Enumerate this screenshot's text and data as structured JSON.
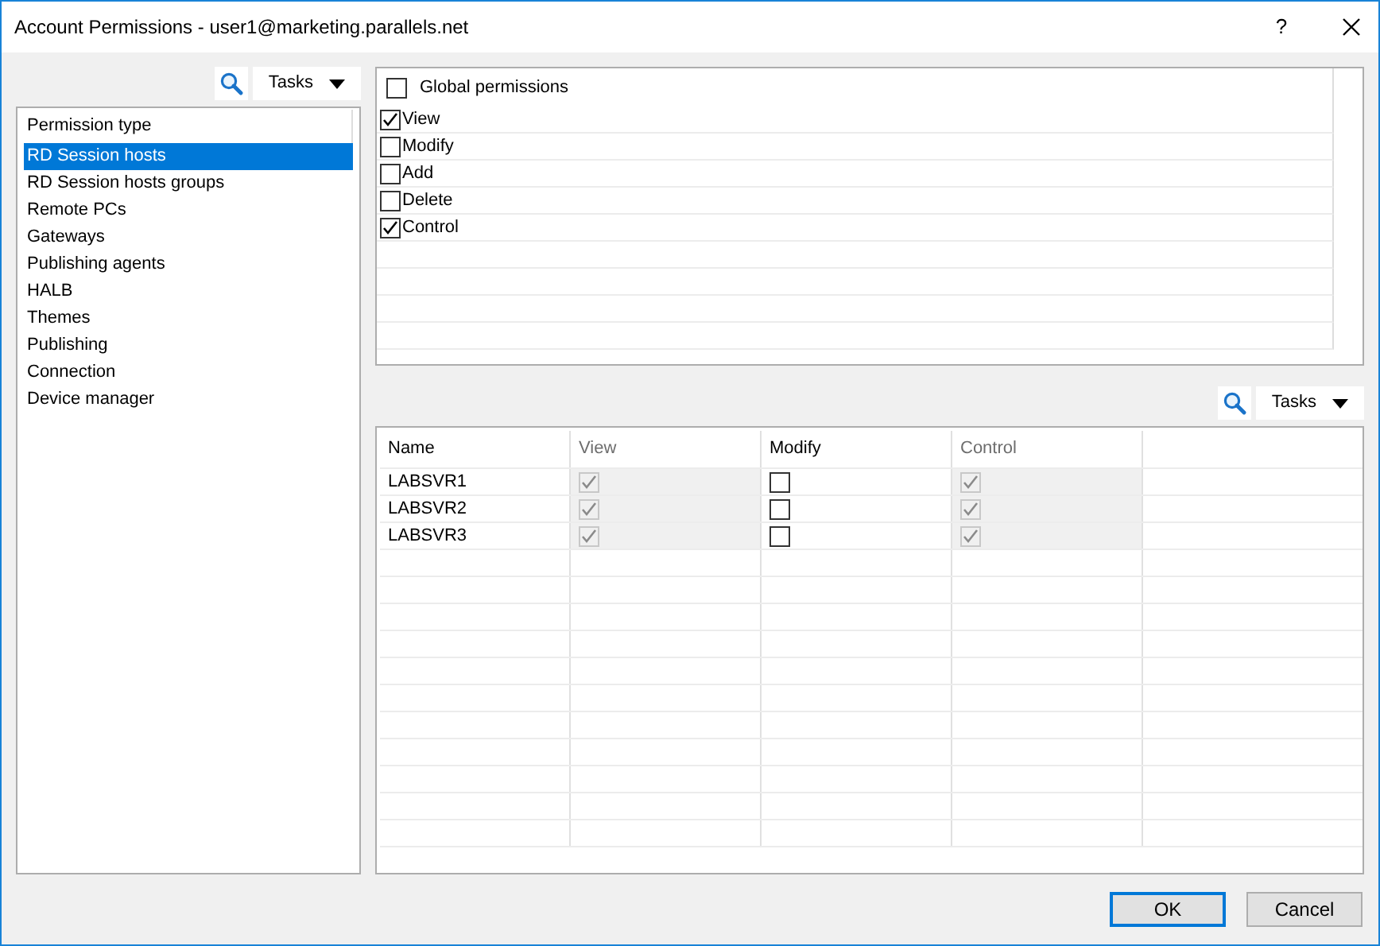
{
  "window": {
    "title": "Account Permissions - user1@marketing.parallels.net",
    "help": "?"
  },
  "permission_types": {
    "tasks_label": "Tasks",
    "header": "Permission type",
    "items": [
      {
        "label": "RD Session hosts",
        "selected": true
      },
      {
        "label": "RD Session hosts groups",
        "selected": false
      },
      {
        "label": "Remote PCs",
        "selected": false
      },
      {
        "label": "Gateways",
        "selected": false
      },
      {
        "label": "Publishing agents",
        "selected": false
      },
      {
        "label": "HALB",
        "selected": false
      },
      {
        "label": "Themes",
        "selected": false
      },
      {
        "label": "Publishing",
        "selected": false
      },
      {
        "label": "Connection",
        "selected": false
      },
      {
        "label": "Device manager",
        "selected": false
      }
    ]
  },
  "permissions": {
    "global": {
      "label": "Global permissions",
      "checked": false
    },
    "items": [
      {
        "label": "View",
        "checked": true
      },
      {
        "label": "Modify",
        "checked": false
      },
      {
        "label": "Add",
        "checked": false
      },
      {
        "label": "Delete",
        "checked": false
      },
      {
        "label": "Control",
        "checked": true
      }
    ]
  },
  "servers": {
    "tasks_label": "Tasks",
    "columns": [
      {
        "label": "Name",
        "disabled": false
      },
      {
        "label": "View",
        "disabled": true
      },
      {
        "label": "Modify",
        "disabled": false
      },
      {
        "label": "Control",
        "disabled": true
      }
    ],
    "rows": [
      {
        "name": "LABSVR1",
        "cells": [
          {
            "checked": true,
            "disabled": true
          },
          {
            "checked": false,
            "disabled": false
          },
          {
            "checked": true,
            "disabled": true
          }
        ]
      },
      {
        "name": "LABSVR2",
        "cells": [
          {
            "checked": true,
            "disabled": true
          },
          {
            "checked": false,
            "disabled": false
          },
          {
            "checked": true,
            "disabled": true
          }
        ]
      },
      {
        "name": "LABSVR3",
        "cells": [
          {
            "checked": true,
            "disabled": true
          },
          {
            "checked": false,
            "disabled": false
          },
          {
            "checked": true,
            "disabled": true
          }
        ]
      }
    ]
  },
  "buttons": [
    {
      "label": "OK",
      "default": true
    },
    {
      "label": "Cancel",
      "default": false
    }
  ]
}
